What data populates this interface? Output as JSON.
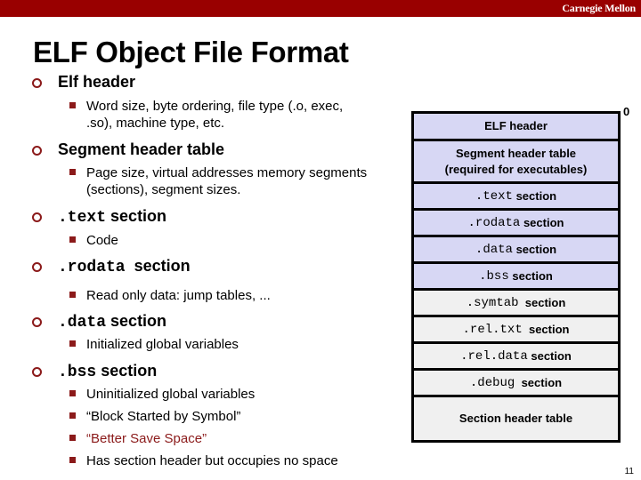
{
  "header": {
    "brand": "Carnegie Mellon",
    "colors": {
      "bar": "#990000",
      "bullet": "#8b1a1a",
      "accent_text": "#8b1a1a"
    }
  },
  "slide": {
    "title": "ELF Object File Format",
    "page_number": "11",
    "bullets": [
      {
        "mono": "",
        "label": "Elf header",
        "subs": [
          {
            "text": "Word size, byte ordering, file type (.o, exec,",
            "cont": ".so), machine type, etc."
          }
        ]
      },
      {
        "mono": "",
        "label": "Segment header table",
        "subs": [
          {
            "text": "Page size, virtual addresses memory segments",
            "cont": "(sections), segment sizes."
          }
        ]
      },
      {
        "mono": ".text",
        "label": "section",
        "subs": [
          {
            "text": "Code"
          }
        ]
      },
      {
        "mono": ".rodata",
        "label": "section",
        "subs": [
          {
            "text": "Read only data: jump tables, ..."
          }
        ]
      },
      {
        "mono": ".data",
        "label": "section",
        "subs": [
          {
            "text": "Initialized global variables"
          }
        ]
      },
      {
        "mono": ".bss",
        "label": "section",
        "subs": [
          {
            "text": "Uninitialized global variables"
          },
          {
            "text": "“Block Started by Symbol”"
          },
          {
            "text": "“Better Save Space”",
            "highlight": true
          },
          {
            "text": "Has section header but occupies no space"
          }
        ]
      }
    ]
  },
  "diagram": {
    "offset_label": "0",
    "rows": [
      {
        "mono": "",
        "label": "ELF header",
        "fill": "blue"
      },
      {
        "mono": "",
        "label": "Segment header table",
        "label2": "(required for executables)",
        "fill": "blue"
      },
      {
        "mono": ".text",
        "label": "section",
        "fill": "blue"
      },
      {
        "mono": ".rodata",
        "label": "section",
        "fill": "blue"
      },
      {
        "mono": ".data",
        "label": "section",
        "fill": "blue"
      },
      {
        "mono": ".bss",
        "label": "section",
        "fill": "blue"
      },
      {
        "mono": ".symtab",
        "label": "section",
        "fill": "grey"
      },
      {
        "mono": ".rel.txt",
        "label": "section",
        "fill": "grey"
      },
      {
        "mono": ".rel.data",
        "label": "section",
        "fill": "grey"
      },
      {
        "mono": ".debug",
        "label": "section",
        "fill": "grey"
      },
      {
        "mono": "",
        "label": "Section header table",
        "fill": "grey"
      }
    ]
  }
}
